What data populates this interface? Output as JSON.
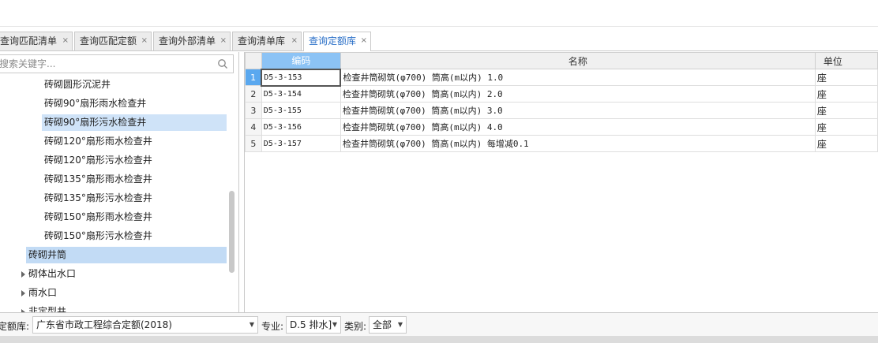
{
  "tabs": [
    {
      "label": "查询匹配清单",
      "close": "×"
    },
    {
      "label": "查询匹配定额",
      "close": "×"
    },
    {
      "label": "查询外部清单",
      "close": "×"
    },
    {
      "label": "查询清单库",
      "close": "×"
    },
    {
      "label": "查询定额库",
      "close": "×",
      "active": true
    }
  ],
  "search": {
    "placeholder": "搜索关键字...",
    "icon": "search-icon"
  },
  "tree": {
    "items": [
      {
        "label": "砖砌圆形沉泥井"
      },
      {
        "label": "砖砌90°扇形雨水检查井"
      },
      {
        "label": "砖砌90°扇形污水检查井"
      },
      {
        "label": "砖砌120°扇形雨水检查井"
      },
      {
        "label": "砖砌120°扇形污水检查井"
      },
      {
        "label": "砖砌135°扇形雨水检查井"
      },
      {
        "label": "砖砌135°扇形污水检查井"
      },
      {
        "label": "砖砌150°扇形雨水检查井"
      },
      {
        "label": "砖砌150°扇形污水检查井"
      },
      {
        "label": "砖砌井筒"
      },
      {
        "label": "砌体出水口"
      },
      {
        "label": "雨水口"
      },
      {
        "label": "非定型井"
      }
    ]
  },
  "grid": {
    "columns": [
      "编码",
      "名称",
      "单位"
    ],
    "rows": [
      {
        "num": "1",
        "code": "D5-3-153",
        "name": "检查井筒砌筑(φ700) 筒高(m以内) 1.0",
        "unit": "座"
      },
      {
        "num": "2",
        "code": "D5-3-154",
        "name": "检查井筒砌筑(φ700) 筒高(m以内) 2.0",
        "unit": "座"
      },
      {
        "num": "3",
        "code": "D5-3-155",
        "name": "检查井筒砌筑(φ700) 筒高(m以内) 3.0",
        "unit": "座"
      },
      {
        "num": "4",
        "code": "D5-3-156",
        "name": "检查井筒砌筑(φ700) 筒高(m以内) 4.0",
        "unit": "座"
      },
      {
        "num": "5",
        "code": "D5-3-157",
        "name": "检查井筒砌筑(φ700) 筒高(m以内) 每增减0.1",
        "unit": "座"
      }
    ]
  },
  "footer": {
    "library_label": "定额库:",
    "library_value": "广东省市政工程综合定额(2018)",
    "major_label": "专业:",
    "major_value": "D.5 排水]",
    "category_label": "类别:",
    "category_value": "全部"
  },
  "colors": {
    "accent": "#2a6fc7",
    "selected": "#cfe3f8",
    "header_sorted": "#8cc3f5",
    "row_current": "#5aa8ef"
  }
}
